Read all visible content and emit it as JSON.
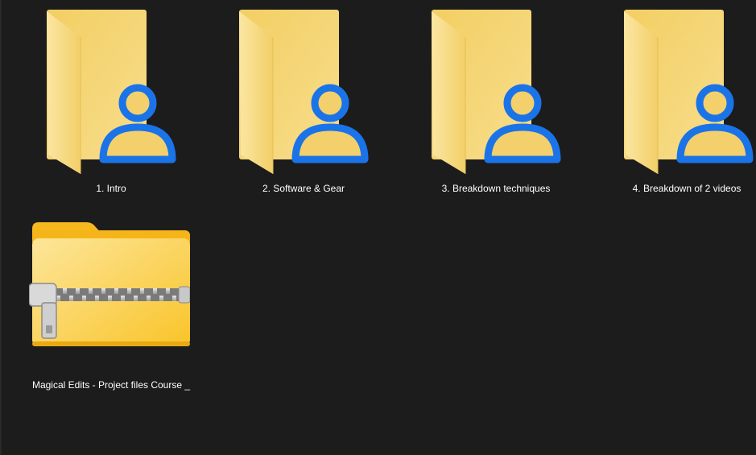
{
  "explorer": {
    "items": [
      {
        "name": "1. Intro",
        "type": "shared-folder",
        "icon": "shared-folder-icon"
      },
      {
        "name": "2. Software & Gear",
        "type": "shared-folder",
        "icon": "shared-folder-icon"
      },
      {
        "name": "3. Breakdown techniques",
        "type": "shared-folder",
        "icon": "shared-folder-icon"
      },
      {
        "name": "4. Breakdown of 2 videos",
        "type": "shared-folder",
        "icon": "shared-folder-icon"
      },
      {
        "name": "Magical Edits - Project files Course _",
        "type": "zip-folder",
        "icon": "zip-folder-icon"
      }
    ]
  },
  "colors": {
    "background": "#1c1c1c",
    "folder_yellow": "#f6d87a",
    "user_badge_blue": "#1b73e8",
    "label_text": "#ffffff"
  }
}
